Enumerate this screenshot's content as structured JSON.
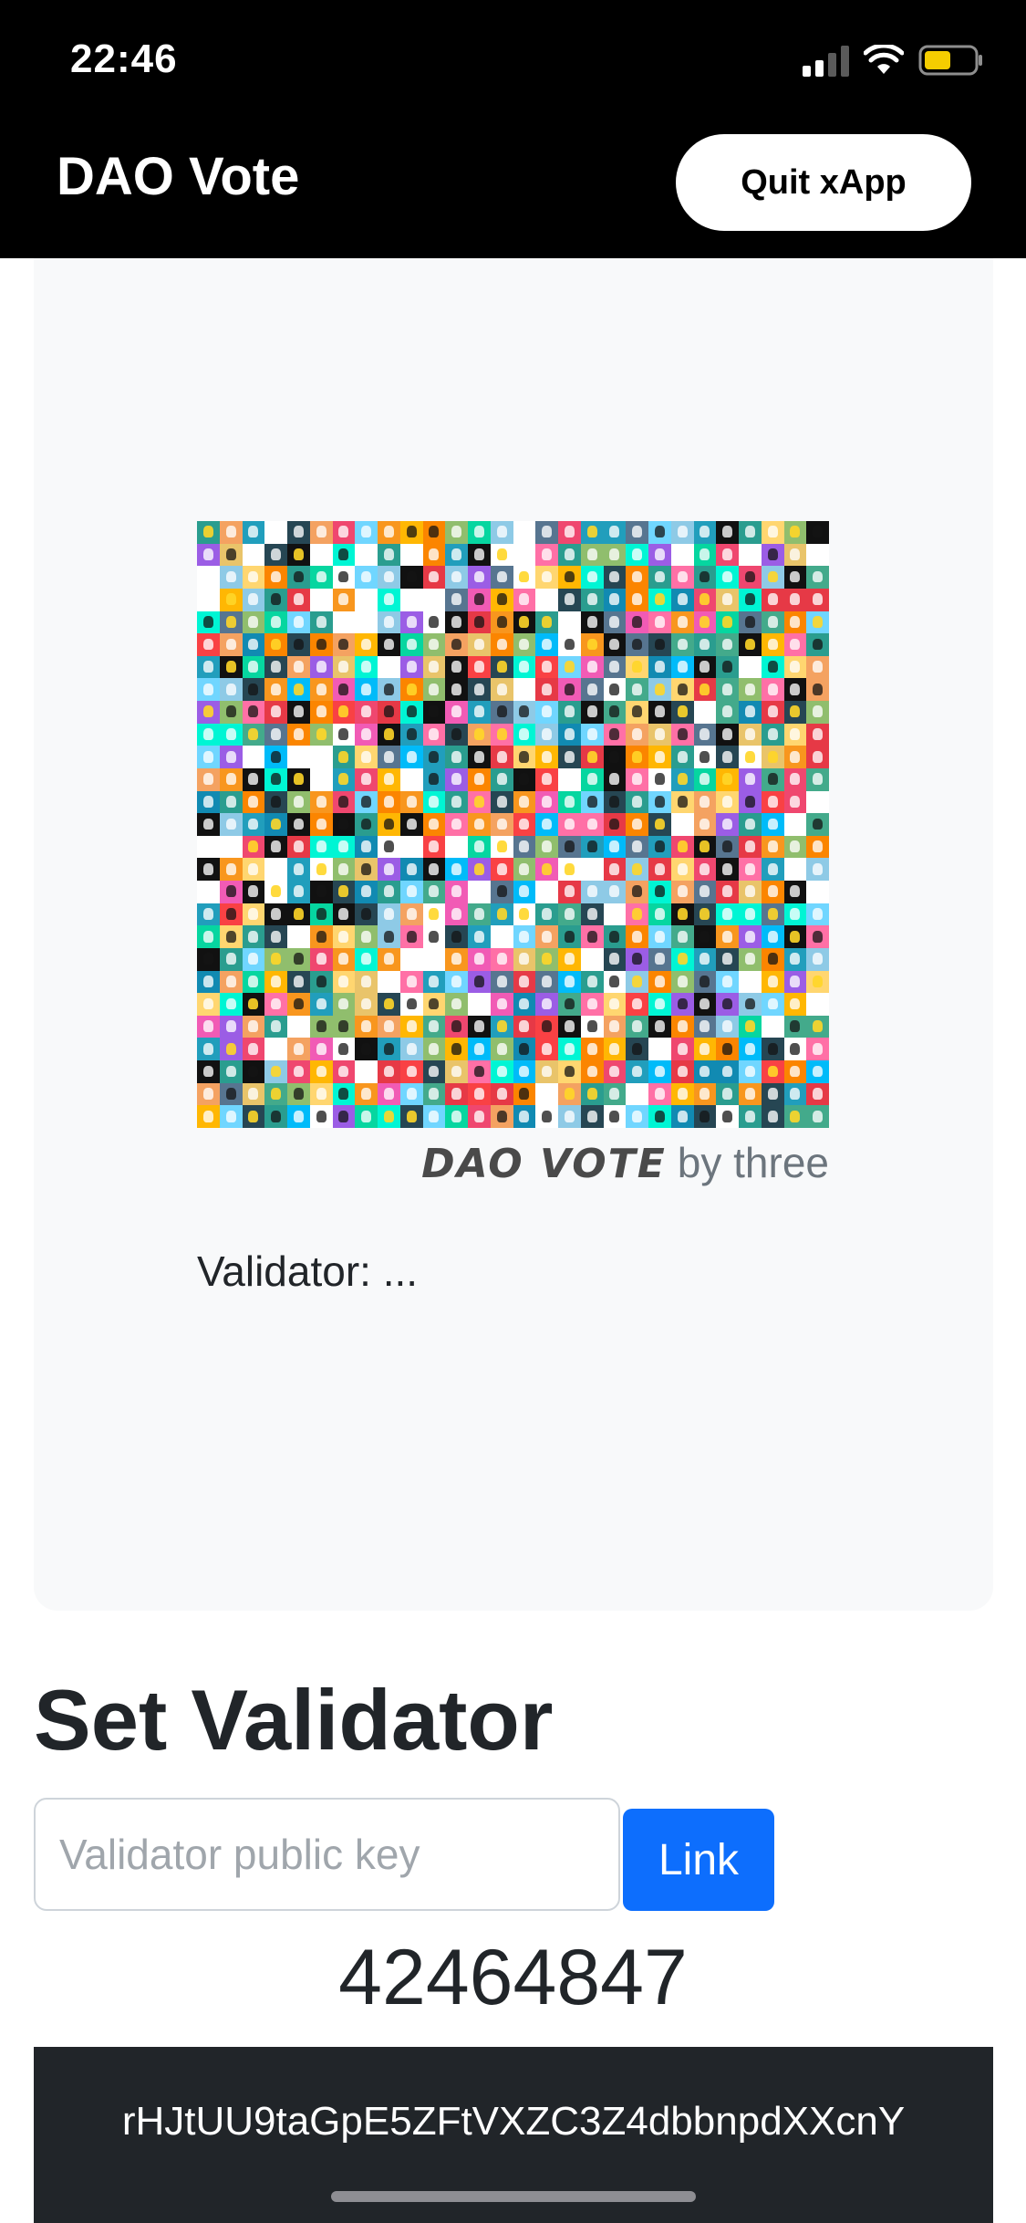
{
  "status_bar": {
    "time": "22:46"
  },
  "header": {
    "title": "DAO Vote",
    "quit_label": "Quit xApp"
  },
  "card": {
    "credit_logo": "DAO VOTE",
    "credit_suffix": "by three",
    "validator_text": "Validator: ..."
  },
  "set_validator": {
    "title": "Set Validator",
    "input_placeholder": "Validator public key",
    "input_value": "",
    "link_label": "Link"
  },
  "number_display": "42464847",
  "address": "rHJtUU9taGpE5ZFtVXZC3Z4dbbnpdXXcnY",
  "colors": {
    "header_bg": "#000000",
    "card_bg": "#f8f9fa",
    "primary_button": "#0d6efd",
    "address_bg": "#212529",
    "battery": "#f5cd00",
    "mosaic_palette": [
      "#e63946",
      "#f4a261",
      "#2a9d8f",
      "#264653",
      "#e9c46a",
      "#8ecae6",
      "#219ebc",
      "#ffb703",
      "#fb8500",
      "#06d6a0",
      "#ef476f",
      "#118ab2",
      "#ff70a6",
      "#70d6ff",
      "#ffd670",
      "#9b5de5",
      "#f15bb5",
      "#00bbf9",
      "#00f5d4",
      "#43aa8b",
      "#f94144",
      "#90be6d",
      "#577590",
      "#f8961e"
    ]
  }
}
